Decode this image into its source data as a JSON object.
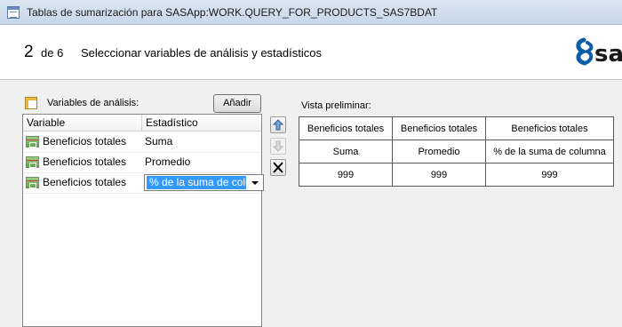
{
  "window": {
    "title": "Tablas de sumarización para SASApp:WORK.QUERY_FOR_PRODUCTS_SAS7BDAT",
    "icon": "table-window-icon"
  },
  "wizard": {
    "step_number": "2",
    "step_of": "de 6",
    "step_title": "Seleccionar variables de análisis y estadísticos",
    "logo": "sas-logo"
  },
  "analysis": {
    "label": "Variables de análisis:",
    "add_button": "Añadir",
    "columns": [
      "Variable",
      "Estadístico"
    ],
    "rows": [
      {
        "variable": "Beneficios totales",
        "statistic": "Suma"
      },
      {
        "variable": "Beneficios totales",
        "statistic": "Promedio"
      },
      {
        "variable": "Beneficios totales",
        "statistic": "% de la suma de columna",
        "editing": true
      }
    ]
  },
  "side_buttons": [
    {
      "name": "move-up-icon",
      "enabled": true
    },
    {
      "name": "move-down-icon",
      "enabled": false
    },
    {
      "name": "delete-icon",
      "enabled": true
    }
  ],
  "preview": {
    "label": "Vista preliminar:",
    "headers": [
      "Beneficios totales",
      "Beneficios totales",
      "Beneficios totales"
    ],
    "stats": [
      "Suma",
      "Promedio",
      "% de la suma de columna"
    ],
    "values": [
      "999",
      "999",
      "999"
    ]
  },
  "colors": {
    "selection": "#3399ff",
    "logo_blue": "#0a5ea8"
  }
}
